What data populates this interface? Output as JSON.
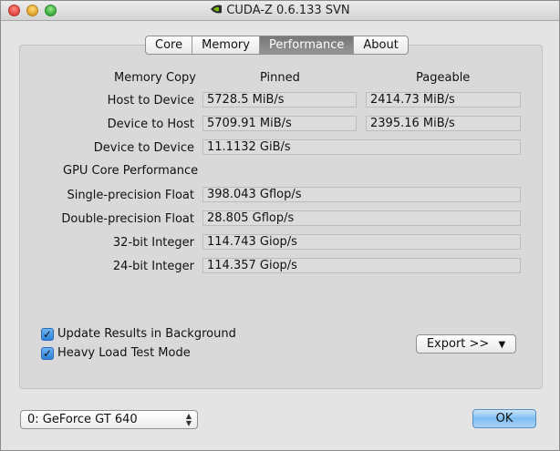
{
  "window": {
    "title": "CUDA-Z 0.6.133 SVN",
    "app_icon": "nvidia-logo-icon"
  },
  "tabs": [
    {
      "label": "Core",
      "active": false
    },
    {
      "label": "Memory",
      "active": false
    },
    {
      "label": "Performance",
      "active": true
    },
    {
      "label": "About",
      "active": false
    }
  ],
  "performance": {
    "memory_copy_header": "Memory Copy",
    "pinned_header": "Pinned",
    "pageable_header": "Pageable",
    "host_to_device": {
      "label": "Host to Device",
      "pinned": "5728.5 MiB/s",
      "pageable": "2414.73 MiB/s"
    },
    "device_to_host": {
      "label": "Device to Host",
      "pinned": "5709.91 MiB/s",
      "pageable": "2395.16 MiB/s"
    },
    "device_to_device": {
      "label": "Device to Device",
      "pinned": "11.1132 GiB/s"
    },
    "gpu_core_header": "GPU Core Performance",
    "single_precision": {
      "label": "Single-precision Float",
      "value": "398.043 Gflop/s"
    },
    "double_precision": {
      "label": "Double-precision Float",
      "value": "28.805 Gflop/s"
    },
    "int32": {
      "label": "32-bit Integer",
      "value": "114.743 Giop/s"
    },
    "int24": {
      "label": "24-bit Integer",
      "value": "114.357 Giop/s"
    }
  },
  "options": {
    "update_background": {
      "label": "Update Results in Background",
      "checked": true
    },
    "heavy_load": {
      "label": "Heavy Load Test Mode",
      "checked": true
    }
  },
  "export_button": "Export >>",
  "device_select": "0: GeForce GT 640",
  "ok_button": "OK",
  "colors": {
    "active_tab": "#808080",
    "checkbox_blue": "#2d7fd9",
    "ok_button_blue": "#7fbdf0"
  }
}
